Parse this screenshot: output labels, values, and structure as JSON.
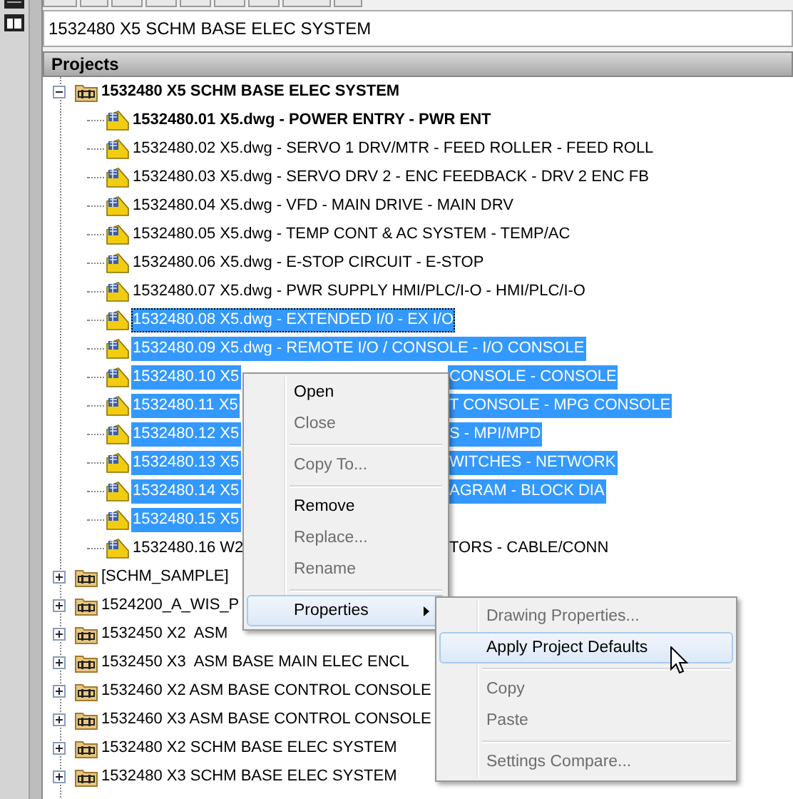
{
  "project_field": {
    "value": "1532480 X5 SCHM BASE ELEC SYSTEM"
  },
  "panel": {
    "title": "Projects"
  },
  "tree": [
    {
      "label": "1532480 X5 SCHM BASE ELEC SYSTEM",
      "bold": true,
      "expanded": true,
      "children": [
        {
          "label": "1532480.01 X5.dwg - POWER ENTRY - PWR ENT",
          "bold": true,
          "selected": false,
          "focused": false
        },
        {
          "label": "1532480.02 X5.dwg - SERVO 1 DRV/MTR - FEED ROLLER - FEED ROLL",
          "bold": false,
          "selected": false,
          "focused": false
        },
        {
          "label": "1532480.03 X5.dwg - SERVO DRV 2 - ENC FEEDBACK - DRV 2 ENC FB",
          "bold": false,
          "selected": false,
          "focused": false
        },
        {
          "label": "1532480.04 X5.dwg - VFD - MAIN DRIVE - MAIN DRV",
          "bold": false,
          "selected": false,
          "focused": false
        },
        {
          "label": "1532480.05 X5.dwg - TEMP CONT & AC SYSTEM - TEMP/AC",
          "bold": false,
          "selected": false,
          "focused": false
        },
        {
          "label": "1532480.06 X5.dwg - E-STOP CIRCUIT - E-STOP",
          "bold": false,
          "selected": false,
          "focused": false
        },
        {
          "label": "1532480.07 X5.dwg - PWR SUPPLY HMI/PLC/I-O - HMI/PLC/I-O",
          "bold": false,
          "selected": false,
          "focused": false
        },
        {
          "label": "1532480.08 X5.dwg - EXTENDED I/0 - EX I/O",
          "bold": false,
          "selected": true,
          "focused": true
        },
        {
          "label": "1532480.09 X5.dwg - REMOTE I/O / CONSOLE - I/O CONSOLE",
          "bold": false,
          "selected": true,
          "focused": false
        },
        {
          "label": "1532480.10 X5",
          "tail": "CONSOLE - CONSOLE",
          "bold": false,
          "selected": true,
          "focused": false
        },
        {
          "label": "1532480.11 X5",
          "tail": "T CONSOLE - MPG CONSOLE",
          "bold": false,
          "selected": true,
          "focused": false
        },
        {
          "label": "1532480.12 X5",
          "tail": "S - MPI/MPD",
          "bold": false,
          "selected": true,
          "focused": false
        },
        {
          "label": "1532480.13 X5",
          "tail": "WITCHES - NETWORK",
          "bold": false,
          "selected": true,
          "focused": false
        },
        {
          "label": "1532480.14 X5",
          "tail": "AGRAM - BLOCK DIA",
          "bold": false,
          "selected": true,
          "focused": false
        },
        {
          "label": "1532480.15 X5",
          "bold": false,
          "selected": true,
          "focused": false
        },
        {
          "label": "1532480.16 W2",
          "tail": "TORS - CABLE/CONN",
          "bold": false,
          "selected": false,
          "focused": false
        }
      ]
    },
    {
      "label": "[SCHM_SAMPLE]",
      "bold": false,
      "expanded": false
    },
    {
      "label": "1524200_A_WIS_P",
      "bold": false,
      "expanded": false
    },
    {
      "label": "1532450 X2  ASM",
      "bold": false,
      "expanded": false
    },
    {
      "label": "1532450 X3  ASM BASE MAIN ELEC ENCL",
      "bold": false,
      "expanded": false
    },
    {
      "label": "1532460 X2 ASM BASE CONTROL CONSOLE",
      "bold": false,
      "expanded": false
    },
    {
      "label": "1532460 X3 ASM BASE CONTROL CONSOLE",
      "bold": false,
      "expanded": false
    },
    {
      "label": "1532480 X2 SCHM BASE ELEC SYSTEM",
      "bold": false,
      "expanded": false
    },
    {
      "label": "1532480 X3 SCHM BASE ELEC SYSTEM",
      "bold": false,
      "expanded": false
    }
  ],
  "context_menu": {
    "items": [
      {
        "kind": "item",
        "label": "Open",
        "disabled": false,
        "highlighted": false
      },
      {
        "kind": "item",
        "label": "Close",
        "disabled": true,
        "highlighted": false
      },
      {
        "kind": "separator"
      },
      {
        "kind": "item",
        "label": "Copy To...",
        "disabled": true,
        "highlighted": false
      },
      {
        "kind": "separator"
      },
      {
        "kind": "item",
        "label": "Remove",
        "disabled": false,
        "highlighted": false
      },
      {
        "kind": "item",
        "label": "Replace...",
        "disabled": true,
        "highlighted": false
      },
      {
        "kind": "item",
        "label": "Rename",
        "disabled": true,
        "highlighted": false
      },
      {
        "kind": "separator"
      },
      {
        "kind": "submenu",
        "label": "Properties",
        "disabled": false,
        "highlighted": true
      }
    ]
  },
  "submenu": {
    "items": [
      {
        "kind": "item",
        "label": "Drawing Properties...",
        "disabled": true,
        "highlighted": false
      },
      {
        "kind": "item",
        "label": "Apply Project Defaults",
        "disabled": false,
        "highlighted": true
      },
      {
        "kind": "separator"
      },
      {
        "kind": "item",
        "label": "Copy",
        "disabled": true,
        "highlighted": false
      },
      {
        "kind": "item",
        "label": "Paste",
        "disabled": true,
        "highlighted": false
      },
      {
        "kind": "separator"
      },
      {
        "kind": "item",
        "label": "Settings Compare...",
        "disabled": true,
        "highlighted": false
      }
    ]
  }
}
